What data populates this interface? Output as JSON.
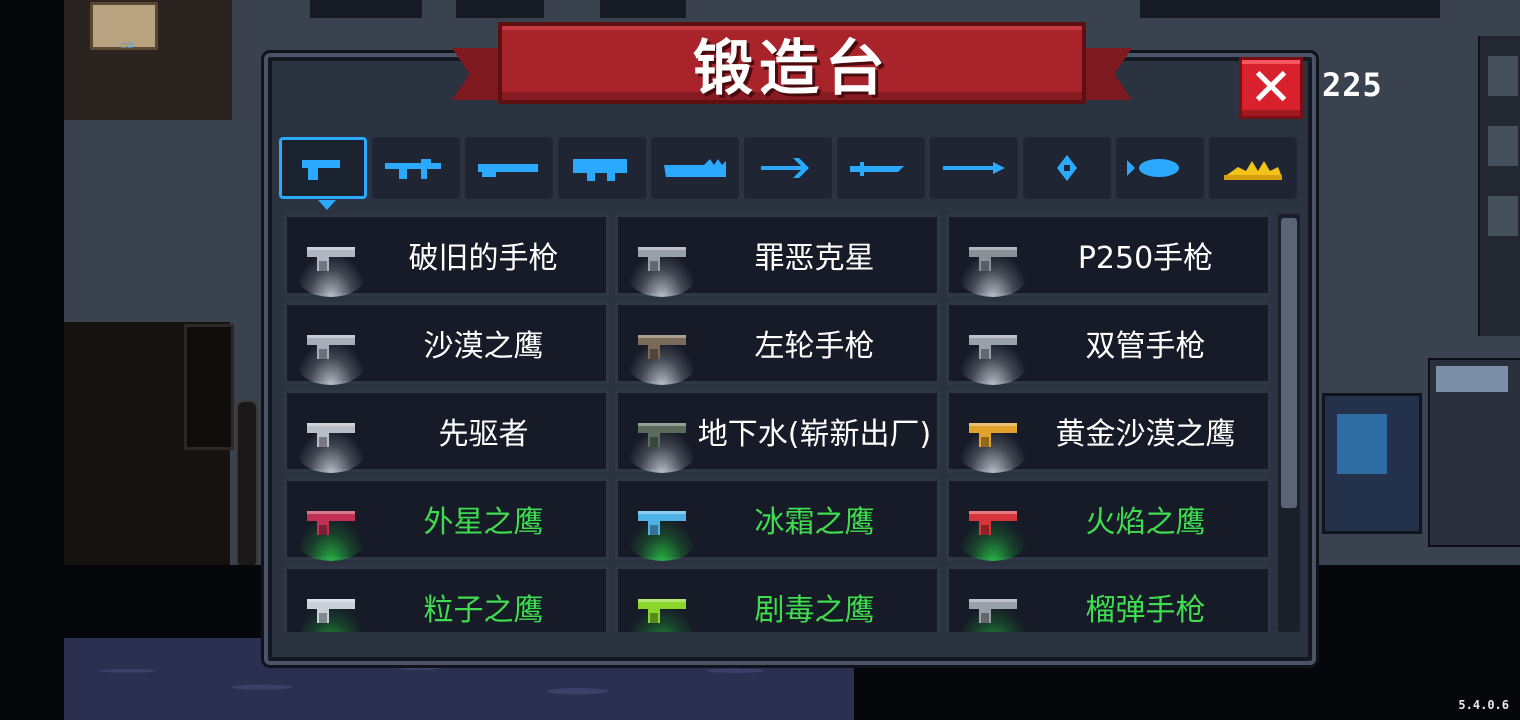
{
  "title": "锻造台",
  "gem_count": "225",
  "close_label": "✕",
  "version": "5.4.0.6",
  "colors": {
    "tab_icon": "#2aa9ff",
    "rare_text": "#3fdc4f",
    "ribbon": "#a8232a",
    "star": "#f2c31a"
  },
  "tabs": [
    {
      "icon": "pistol-icon",
      "active": true
    },
    {
      "icon": "rifle-icon",
      "active": false
    },
    {
      "icon": "shotgun-icon",
      "active": false
    },
    {
      "icon": "launcher-icon",
      "active": false
    },
    {
      "icon": "laser-rifle-icon",
      "active": false
    },
    {
      "icon": "bow-icon",
      "active": false
    },
    {
      "icon": "sword-icon",
      "active": false
    },
    {
      "icon": "spear-icon",
      "active": false
    },
    {
      "icon": "staff-icon",
      "active": false
    },
    {
      "icon": "fish-icon",
      "active": false
    },
    {
      "icon": "star-icon",
      "active": false
    }
  ],
  "weapons": [
    {
      "name": "破旧的手枪",
      "rarity": "white",
      "color": "#b0b6c2"
    },
    {
      "name": "罪恶克星",
      "rarity": "white",
      "color": "#9aa0aa"
    },
    {
      "name": "P250手枪",
      "rarity": "white",
      "color": "#8a8f98"
    },
    {
      "name": "沙漠之鹰",
      "rarity": "white",
      "color": "#a7adb8"
    },
    {
      "name": "左轮手枪",
      "rarity": "white",
      "color": "#7c6a58"
    },
    {
      "name": "双管手枪",
      "rarity": "white",
      "color": "#9aa0aa"
    },
    {
      "name": "先驱者",
      "rarity": "white",
      "color": "#b8bcc4"
    },
    {
      "name": "地下水(崭新出厂)",
      "rarity": "white",
      "color": "#5a6b5c"
    },
    {
      "name": "黄金沙漠之鹰",
      "rarity": "white",
      "color": "#e0a22a"
    },
    {
      "name": "外星之鹰",
      "rarity": "green",
      "color": "#c03050"
    },
    {
      "name": "冰霜之鹰",
      "rarity": "green",
      "color": "#4fb2e6"
    },
    {
      "name": "火焰之鹰",
      "rarity": "green",
      "color": "#d8353a"
    },
    {
      "name": "粒子之鹰",
      "rarity": "green",
      "color": "#c9d0da"
    },
    {
      "name": "剧毒之鹰",
      "rarity": "green",
      "color": "#8ad62a"
    },
    {
      "name": "榴弹手枪",
      "rarity": "green",
      "color": "#9aa0aa"
    }
  ]
}
